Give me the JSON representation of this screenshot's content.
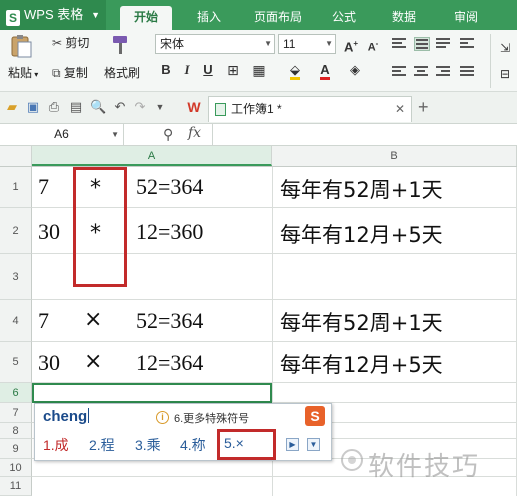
{
  "app": {
    "name": "WPS 表格",
    "logo_letter": "S"
  },
  "tabs": [
    {
      "label": "开始",
      "active": true
    },
    {
      "label": "插入"
    },
    {
      "label": "页面布局"
    },
    {
      "label": "公式"
    },
    {
      "label": "数据"
    },
    {
      "label": "审阅"
    }
  ],
  "ribbon": {
    "paste": "粘贴",
    "cut": "剪切",
    "copy": "复制",
    "format_painter": "格式刷",
    "font_name": "宋体",
    "font_size": "11",
    "grow": "A",
    "shrink": "A",
    "bold": "B",
    "italic": "I",
    "underline": "U",
    "font_color_letter": "A"
  },
  "document": {
    "tab_title": "工作簿1 *"
  },
  "formula_bar": {
    "name_box": "A6",
    "fx": "fx",
    "formula": ""
  },
  "columns": [
    "A",
    "B"
  ],
  "rows": [
    "1",
    "2",
    "3",
    "4",
    "5",
    "6",
    "7",
    "8",
    "9",
    "10",
    "11"
  ],
  "cells": {
    "r1": {
      "a1": "7",
      "a2": "*",
      "a3": "52=364",
      "b": "每年有52周+1天"
    },
    "r2": {
      "a1": "30",
      "a2": "*",
      "a3": "12=360",
      "b": "每年有12月+5天"
    },
    "r4": {
      "a1": "7",
      "a2": "×",
      "a3": "52=364",
      "b": "每年有52周+1天"
    },
    "r5": {
      "a1": "30",
      "a2": "×",
      "a3": "12=364",
      "b": "每年有12月+5天"
    }
  },
  "ime": {
    "pinyin": "cheng",
    "tip": "6.更多特殊符号",
    "candidates": [
      "1.成",
      "2.程",
      "3.乘",
      "4.称",
      "5.×"
    ]
  },
  "watermark": "软件技巧",
  "colors": {
    "accent": "#3a9a5b",
    "highlight_red": "#c22a2a"
  }
}
